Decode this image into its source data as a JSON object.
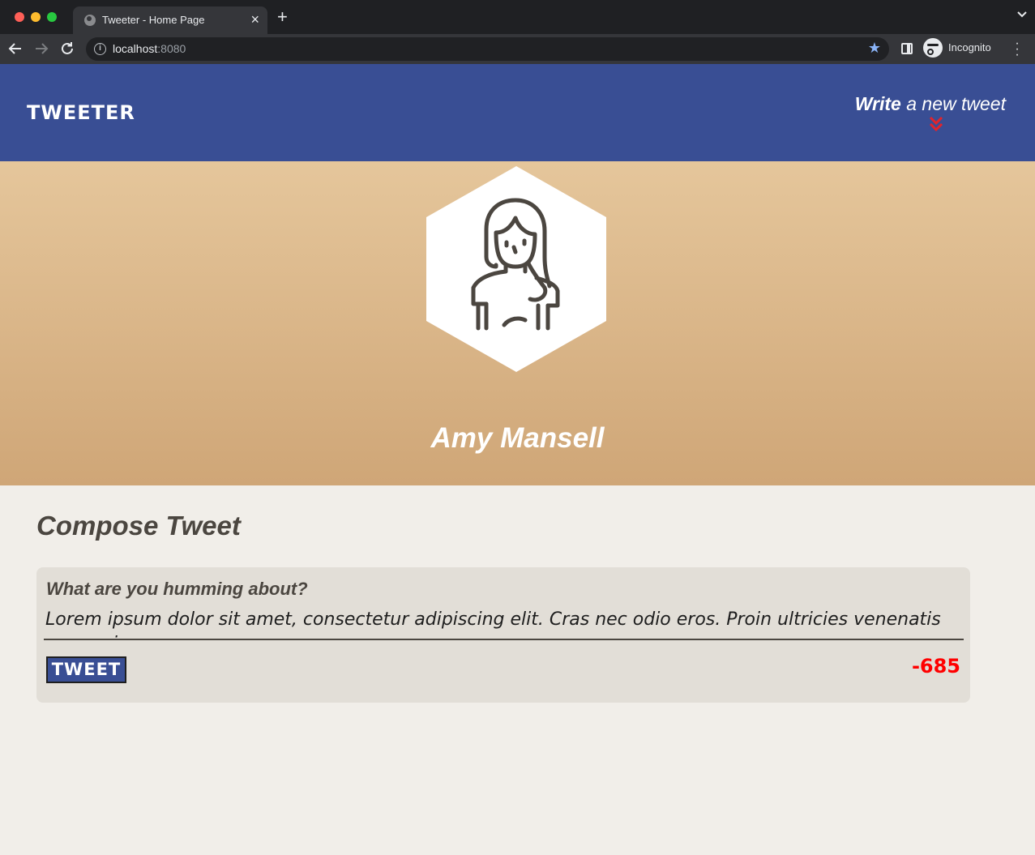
{
  "browser": {
    "tab_title": "Tweeter - Home Page",
    "tab_close": "×",
    "new_tab": "+",
    "url_host": "localhost",
    "url_port": ":8080",
    "profile_label": "Incognito",
    "accent_color": "#8ab4f8"
  },
  "header": {
    "logo": "TWEETER",
    "write_strong": "Write",
    "write_rest": " a new tweet",
    "background_color": "#394e94",
    "chevron_color": "#e3232b"
  },
  "profile": {
    "name": "Amy Mansell",
    "avatar_icon": "woman-avatar-icon"
  },
  "compose": {
    "title": "Compose Tweet",
    "label": "What are you humming about?",
    "text": "Lorem ipsum dolor sit amet, consectetur adipiscing elit. Cras nec odio eros. Proin ultricies venenatis augue, in posuere",
    "button_label": "TWEET",
    "counter": "-685",
    "counter_color": "#ff0000"
  }
}
